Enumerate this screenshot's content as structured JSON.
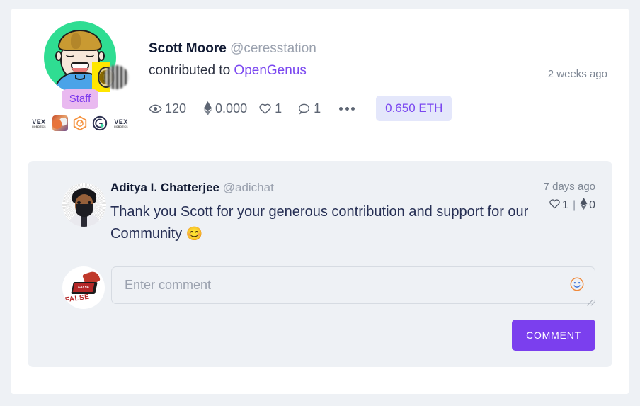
{
  "post": {
    "author_name": "Scott Moore",
    "author_handle": "@ceresstation",
    "action_text": "contributed to",
    "project_name": "OpenGenus",
    "timestamp": "2 weeks ago",
    "staff_badge": "Staff",
    "stats": {
      "views_icon": "eye-icon",
      "views": "120",
      "eth_icon": "ethereum-icon",
      "eth_amount": "0.000",
      "like_icon": "heart-icon",
      "likes": "1",
      "comment_icon": "speech-bubble-icon",
      "comments": "1",
      "more_icon": "ellipsis-icon"
    },
    "contribution_amount": "0.650 ETH",
    "mini_badges": [
      {
        "name": "vex-robotics-badge",
        "label_top": "VEX",
        "label_bottom": "ROBOTICS"
      },
      {
        "name": "fox-artwork-badge",
        "label_top": "",
        "label_bottom": ""
      },
      {
        "name": "orange-hexagon-badge",
        "label_top": "",
        "label_bottom": ""
      },
      {
        "name": "dark-circle-badge",
        "label_top": "",
        "label_bottom": ""
      },
      {
        "name": "vex-robotics-badge-2",
        "label_top": "VEX",
        "label_bottom": "ROBOTICS"
      }
    ]
  },
  "comment": {
    "author_name": "Aditya I. Chatterjee",
    "author_handle": "@adichat",
    "timestamp": "7 days ago",
    "text": "Thank you Scott for your generous contribution and support for our Community",
    "emoji": "😊",
    "like_icon": "heart-icon",
    "likes": "1",
    "separator": "|",
    "eth_icon": "ethereum-icon",
    "eth_amount": "0"
  },
  "composer": {
    "placeholder": "Enter comment",
    "value": "",
    "emoji_icon": "smiley-face-icon",
    "submit_label": "COMMENT",
    "avatar_stamp_text": "FALSE"
  },
  "colors": {
    "accent_purple": "#7b3fee",
    "link_purple": "#7b48f0",
    "eth_pill_bg": "#e4e7fb",
    "panel_bg": "#eef1f5",
    "page_bg": "#eef1f5",
    "card_bg": "#ffffff",
    "staff_badge_bg": "#e9b9f0",
    "avatar_bg": "#2fdd92"
  }
}
